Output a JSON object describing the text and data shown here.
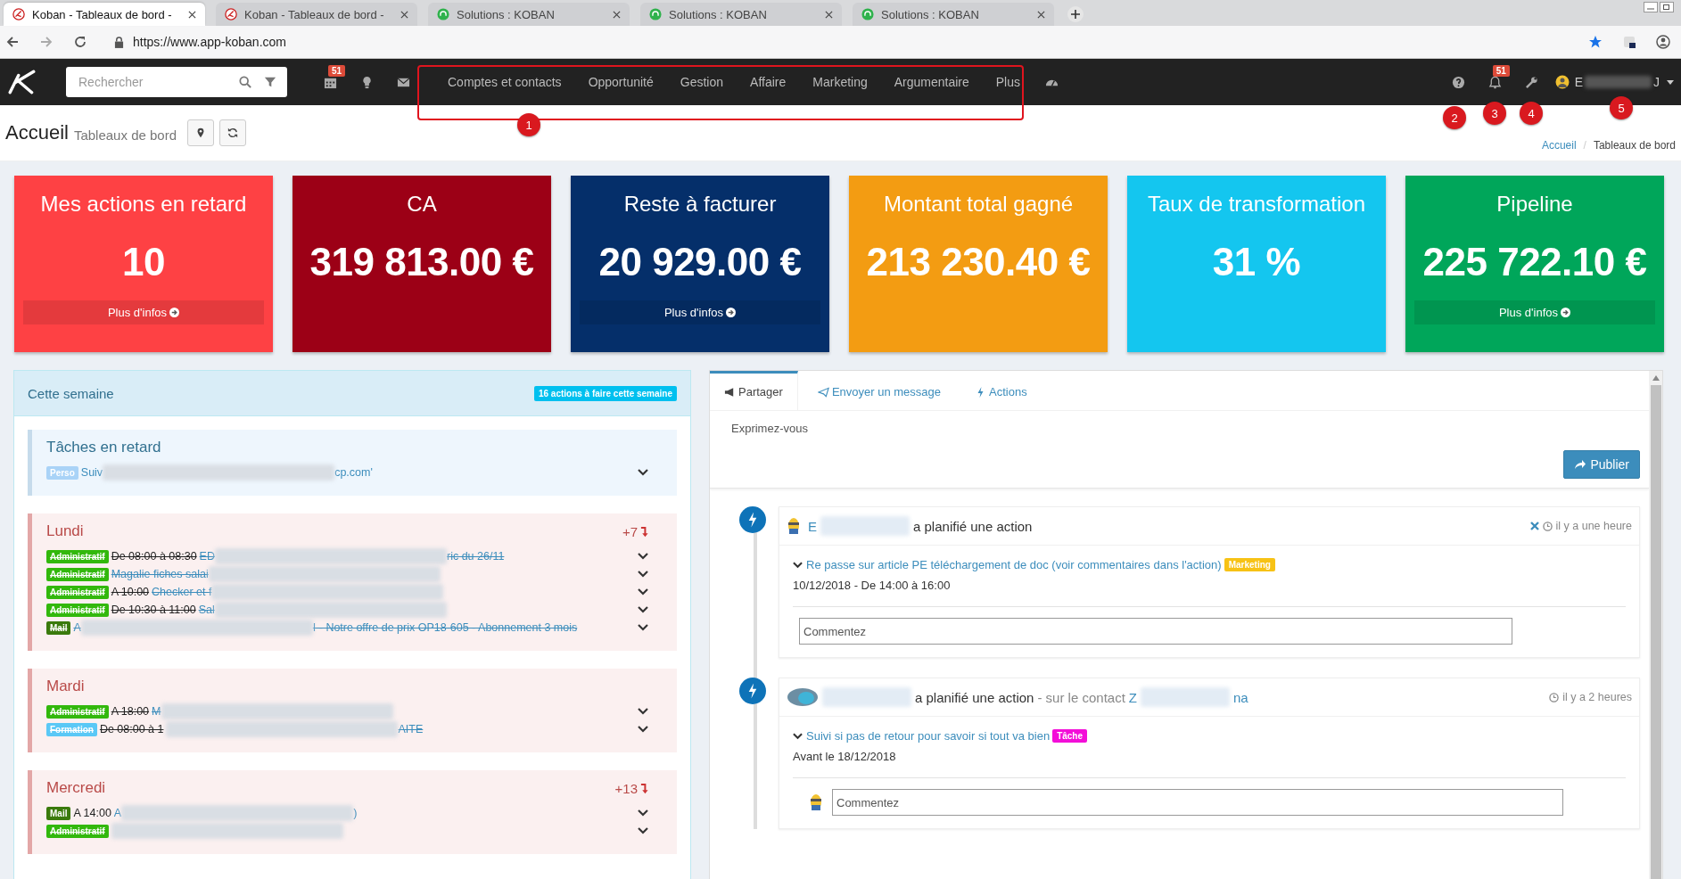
{
  "browser": {
    "tabs": [
      {
        "title": "Koban - Tableaux de bord -",
        "kind": "koban",
        "selected": true
      },
      {
        "title": "Koban - Tableaux de bord -",
        "kind": "koban",
        "selected": false
      },
      {
        "title": "Solutions : KOBAN",
        "kind": "support",
        "selected": false
      },
      {
        "title": "Solutions : KOBAN",
        "kind": "support",
        "selected": false
      },
      {
        "title": "Solutions : KOBAN",
        "kind": "support",
        "selected": false
      }
    ],
    "url": "https://www.app-koban.com"
  },
  "navbar": {
    "search": {
      "placeholder": "Rechercher"
    },
    "calendar_badge": "51",
    "menu": [
      {
        "label": "Comptes et contacts"
      },
      {
        "label": "Opportunité"
      },
      {
        "label": "Gestion"
      },
      {
        "label": "Affaire"
      },
      {
        "label": "Marketing"
      },
      {
        "label": "Argumentaire"
      },
      {
        "label": "Plus"
      }
    ],
    "notification_badge": "51",
    "user": {
      "name_start": "E",
      "name_end": "J"
    }
  },
  "annotations": [
    {
      "label": "1"
    },
    {
      "label": "2"
    },
    {
      "label": "3"
    },
    {
      "label": "4"
    },
    {
      "label": "5"
    }
  ],
  "header": {
    "title": "Accueil",
    "subtitle": "Tableaux de bord",
    "breadcrumb": [
      "Accueil",
      "Tableaux de bord"
    ],
    "breadcrumb_separator": "/"
  },
  "cards": [
    {
      "title": "Mes actions en retard",
      "value": "10",
      "link": "Plus d'infos",
      "color": "#fe4144"
    },
    {
      "title": "CA",
      "value": "319 813.00 €",
      "color": "#9c0016"
    },
    {
      "title": "Reste à facturer",
      "value": "20 929.00 €",
      "link": "Plus d'infos",
      "color": "#052f6a"
    },
    {
      "title": "Montant total gagné",
      "value": "213 230.40 €",
      "color": "#f39c12"
    },
    {
      "title": "Taux de transformation",
      "value": "31 %",
      "color": "#14c6ef"
    },
    {
      "title": "Pipeline",
      "value": "225 722.10 €",
      "link": "Plus d'infos",
      "color": "#00a65a"
    }
  ],
  "week": {
    "title": "Cette semaine",
    "badge": "16 actions à faire cette semaine",
    "sections": [
      {
        "kind": "overdue",
        "title": "Tâches en retard",
        "items": [
          {
            "tag": "Perso",
            "color": "#a9d3f7",
            "done": false,
            "text": "Suiv",
            "redacted": true,
            "text_end": "cp.com'"
          }
        ]
      },
      {
        "kind": "day",
        "title": "Lundi",
        "count": "+7",
        "items": [
          {
            "tag": "Administratif",
            "color": "#32b80c",
            "done": true,
            "time": "De 08:00 à 08:30",
            "text": "ED",
            "redacted": true,
            "text_end": "ric du 26/11"
          },
          {
            "tag": "Administratif",
            "color": "#32b80c",
            "done": true,
            "text": "Magalie fiches salai",
            "redacted": true
          },
          {
            "tag": "Administratif",
            "color": "#32b80c",
            "done": true,
            "time": "A 10:00",
            "text": "Checker et f",
            "redacted": true
          },
          {
            "tag": "Administratif",
            "color": "#32b80c",
            "done": true,
            "time": "De 10:30 à 11:00",
            "text": "Sal",
            "redacted": true
          },
          {
            "tag": "Mail",
            "color": "#3a7a0c",
            "done": true,
            "text": "A",
            "redacted": true,
            "text_end": "I - Notre offre de prix OP18-605 - Abonnement 3 mois"
          }
        ]
      },
      {
        "kind": "day",
        "title": "Mardi",
        "items": [
          {
            "tag": "Administratif",
            "color": "#32b80c",
            "done": true,
            "time": "A 18:00",
            "text": "M",
            "redacted": true
          },
          {
            "tag": "Formation",
            "color": "#5ac8f6",
            "done": true,
            "time": "De 08:00 à 1",
            "redacted": true,
            "text_end": "AITE"
          }
        ]
      },
      {
        "kind": "day",
        "title": "Mercredi",
        "count": "+13",
        "items": [
          {
            "tag": "Mail",
            "color": "#3a7a0c",
            "done": false,
            "time": "A 14:00",
            "text": "A",
            "redacted": true,
            "text_end": ")"
          },
          {
            "tag": "Administratif",
            "color": "#32b80c",
            "done": true,
            "redacted": true
          }
        ]
      }
    ]
  },
  "feed": {
    "tabs": [
      {
        "label": "Partager",
        "selected": true
      },
      {
        "label": "Envoyer un message",
        "selected": false
      },
      {
        "label": "Actions",
        "selected": false
      }
    ],
    "composer": {
      "placeholder": "Exprimez-vous"
    },
    "publish_button": "Publier",
    "posts": [
      {
        "author_start": "E",
        "verb": "a planifié une action",
        "time": "il y a une heure",
        "closable": true,
        "action": "Re passe sur article PE téléchargement de doc (voir commentaires dans l'action)",
        "tag": "Marketing",
        "color": "#f7c215",
        "date": "10/12/2018 - De 14:00 à 16:00",
        "comment": {
          "placeholder": "Commentez"
        }
      },
      {
        "verb": "a planifié une action",
        "context": "- sur le contact",
        "contact_start": "Z",
        "contact_end": "na",
        "time": "il y a 2 heures",
        "closable": false,
        "action": "Suivi si pas de retour pour savoir si tout va bien",
        "tag": "Tâche",
        "color": "#f30ed8",
        "date": "Avant le 18/12/2018",
        "comment": {
          "placeholder": "Commentez"
        },
        "comment_avatar": true
      }
    ]
  }
}
